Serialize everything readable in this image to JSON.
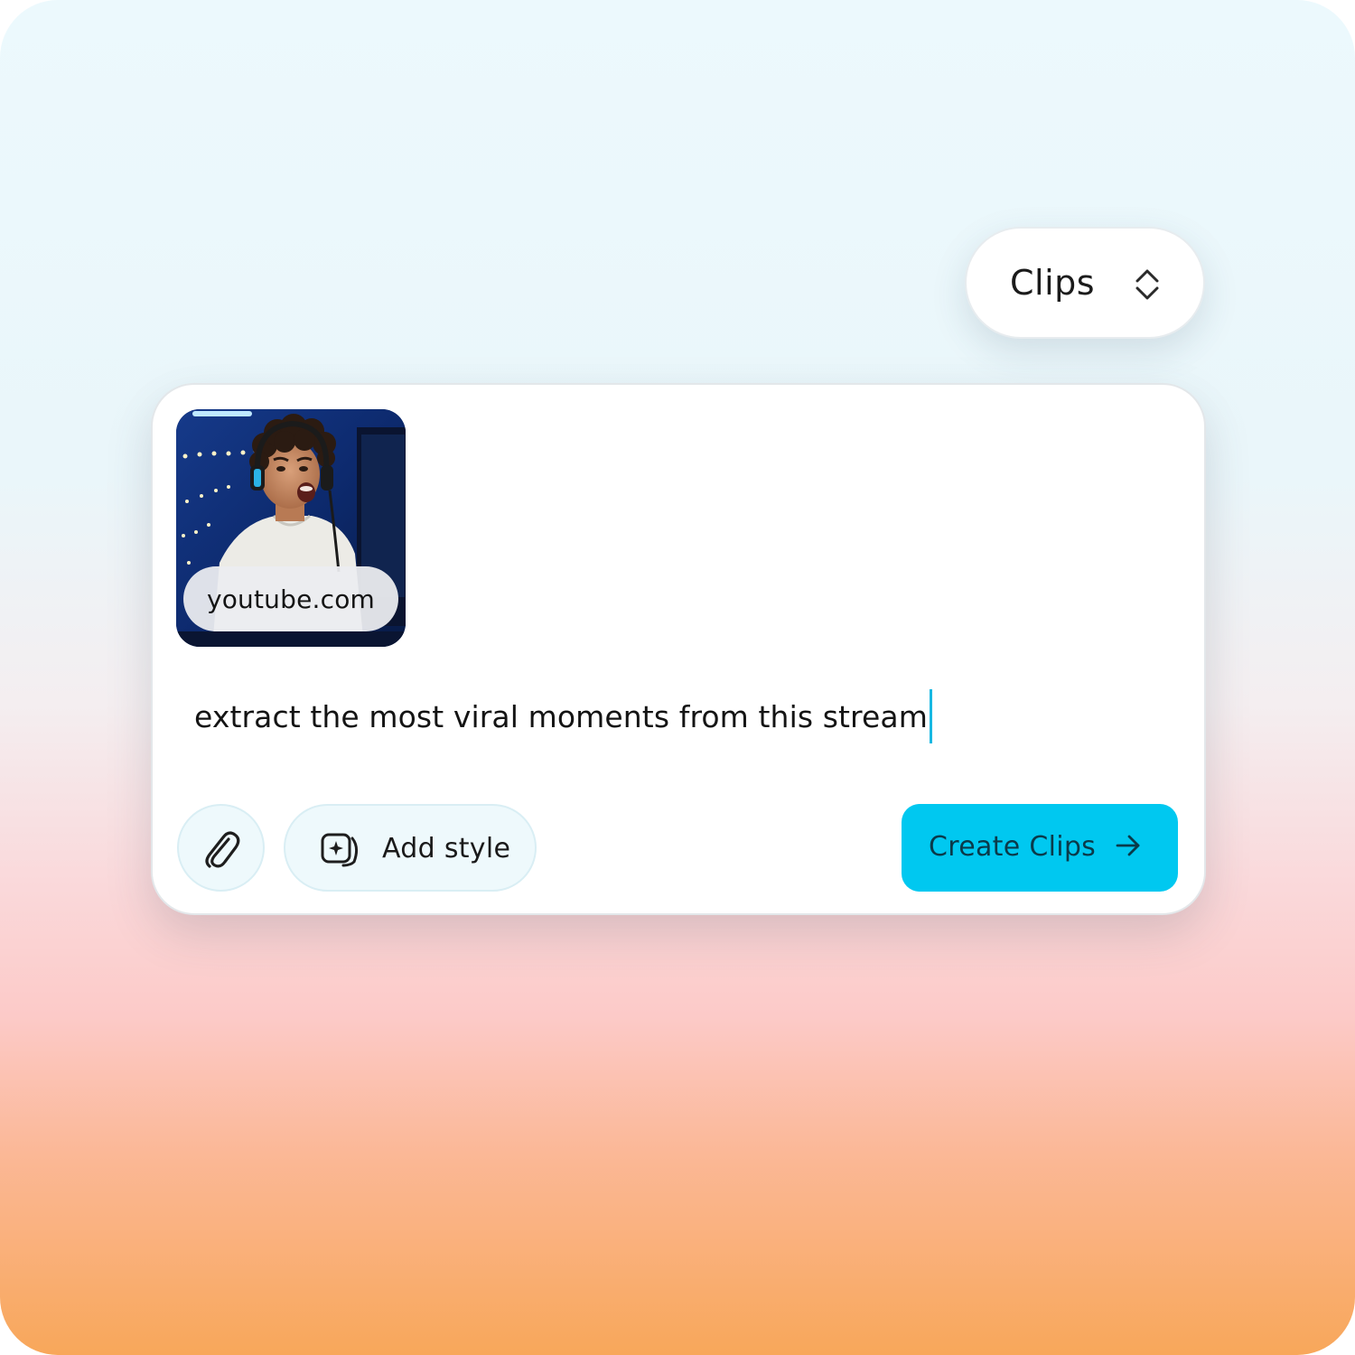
{
  "mode_selector": {
    "label": "Clips",
    "icon": "chevron-up-down-icon"
  },
  "attachment": {
    "source_label": "youtube.com",
    "thumbnail": "gamer-streaming-photo"
  },
  "prompt": {
    "text": "extract the most viral moments from this stream"
  },
  "toolbar": {
    "attach_icon": "paperclip-icon",
    "add_style_label": "Add style",
    "add_style_icon": "style-sparkle-icon",
    "create_label": "Create Clips",
    "create_icon": "arrow-right-icon"
  },
  "colors": {
    "accent": "#00c8f0",
    "caret": "#18b8e2"
  }
}
